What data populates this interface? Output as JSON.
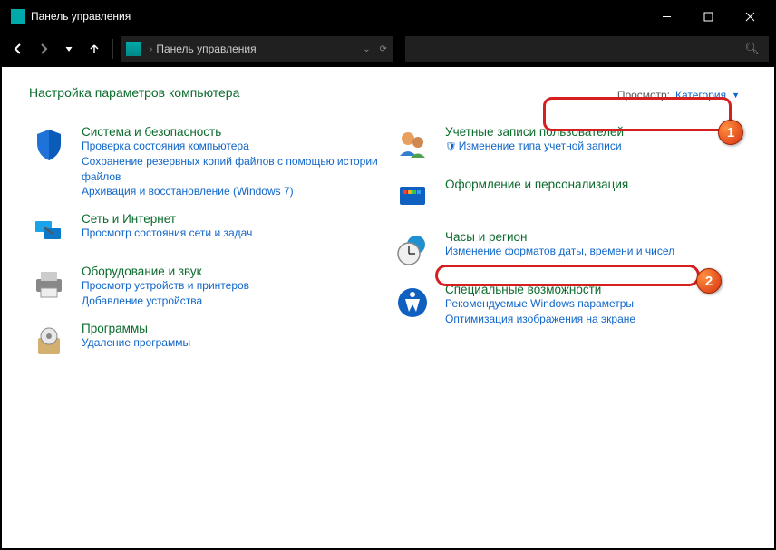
{
  "title": "Панель управления",
  "breadcrumb": "Панель управления",
  "heading": "Настройка параметров компьютера",
  "view": {
    "label": "Просмотр:",
    "value": "Категория"
  },
  "badges": {
    "one": "1",
    "two": "2"
  },
  "left": [
    {
      "title": "Система и безопасность",
      "links": [
        "Проверка состояния компьютера",
        "Сохранение резервных копий файлов с помощью истории файлов",
        "Архивация и восстановление (Windows 7)"
      ]
    },
    {
      "title": "Сеть и Интернет",
      "links": [
        "Просмотр состояния сети и задач"
      ]
    },
    {
      "title": "Оборудование и звук",
      "links": [
        "Просмотр устройств и принтеров",
        "Добавление устройства"
      ]
    },
    {
      "title": "Программы",
      "links": [
        "Удаление программы"
      ]
    }
  ],
  "right": [
    {
      "title": "Учетные записи пользователей",
      "links": [
        "Изменение типа учетной записи"
      ],
      "shield": true
    },
    {
      "title": "Оформление и персонализация",
      "links": []
    },
    {
      "title": "Часы и регион",
      "links": [
        "Изменение форматов даты, времени и чисел"
      ]
    },
    {
      "title": "Специальные возможности",
      "links": [
        "Рекомендуемые Windows параметры",
        "Оптимизация изображения на экране"
      ]
    }
  ]
}
